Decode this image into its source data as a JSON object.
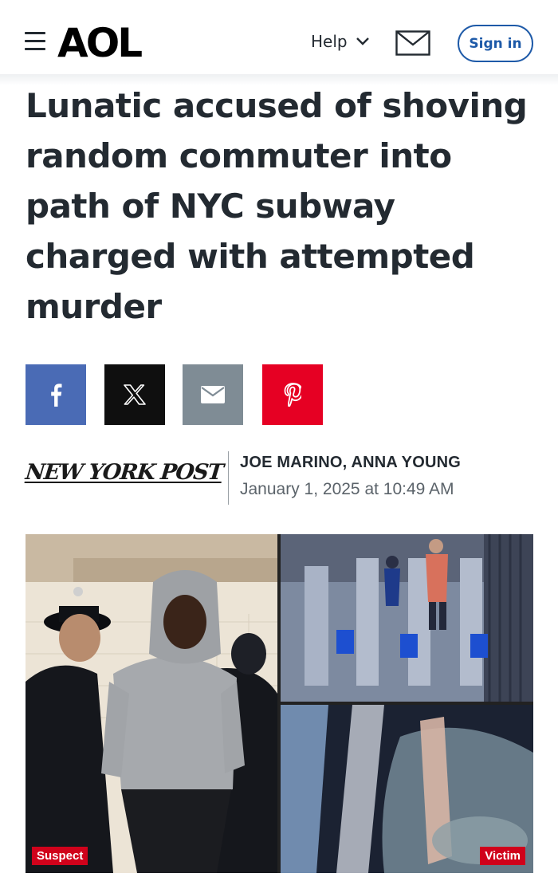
{
  "header": {
    "logo": "AOL",
    "help_label": "Help",
    "signin_label": "Sign in"
  },
  "article": {
    "headline": "Lunatic accused of shoving random commuter into path of NYC subway charged with attempted murder",
    "source": "NEW YORK POST",
    "authors": "JOE MARINO, ANNA YOUNG",
    "date": "January 1, 2025 at 10:49 AM"
  },
  "share": [
    {
      "name": "facebook",
      "icon": "facebook-icon",
      "color": "#4a6bb5"
    },
    {
      "name": "x",
      "icon": "x-icon",
      "color": "#0f0f0f"
    },
    {
      "name": "email",
      "icon": "email-icon",
      "color": "#7f8c95"
    },
    {
      "name": "pinterest",
      "icon": "pinterest-icon",
      "color": "#e60023"
    }
  ],
  "image": {
    "suspect_label": "Suspect",
    "victim_label": "Victim"
  },
  "colors": {
    "accent": "#1e5aa8",
    "tag_red": "#d0021b",
    "text": "#232a31"
  }
}
